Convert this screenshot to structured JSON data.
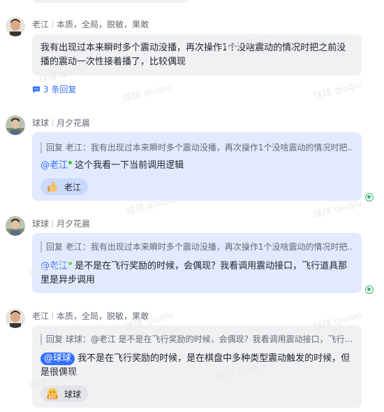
{
  "messages": [
    {
      "author": "老江",
      "tags": [
        "本质",
        "全局",
        "脱敏",
        "果敢"
      ],
      "text": "我有出现过本来瞬时多个震动没播，再次操作1个没啥震动的情况时把之前没播的震动一次性接着播了，比较偶现",
      "replies": "3 条回复"
    },
    {
      "author": "球球",
      "tags": [
        "月夕花晨"
      ],
      "quote": "回复 老江：我有出现过本来瞬时多个震动没播，再次操作1个没啥震动的情况时把...",
      "mention": "@老江",
      "text": "这个我看一下当前调用逻辑",
      "reaction_user": "老江"
    },
    {
      "author": "球球",
      "tags": [
        "月夕花晨"
      ],
      "quote": "回复 老江：我有出现过本来瞬时多个震动没播，再次操作1个没啥震动的情况时把...",
      "mention": "@老江",
      "text": "是不是在飞行奖励的时候，会偶现？我看调用震动接口，飞行道具那里是异步调用"
    },
    {
      "author": "老江",
      "tags": [
        "本质",
        "全局",
        "脱敏",
        "果敢"
      ],
      "quote": "回复 球球：@老江 是不是在飞行奖励的时候，会偶现？我看调用震动接口，飞行...",
      "mention": "@球球",
      "text": "我不是在飞行奖励的时候，是在棋盘中多种类型震动触发的时候，但是很偶现",
      "reaction_user": "球球"
    }
  ],
  "watermark": "球球 qiuqiu",
  "colors": {
    "accent": "#3370ff",
    "blue_bubble": "#e1eaff",
    "gray_bubble": "#f0f1f3",
    "read": "#34b36d"
  }
}
